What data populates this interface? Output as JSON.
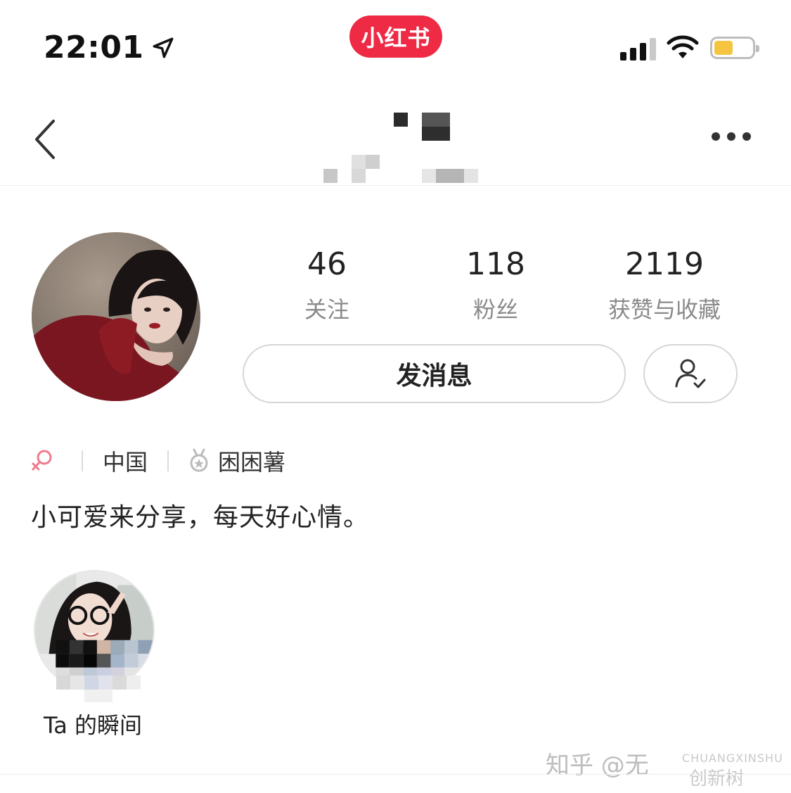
{
  "status_bar": {
    "time": "22:01",
    "app_badge": "小红书",
    "battery_color": "#f5c542"
  },
  "nav": {
    "back_icon": "chevron-left-icon",
    "more_icon": "ellipsis-icon"
  },
  "profile": {
    "stats": [
      {
        "value": "46",
        "label": "关注"
      },
      {
        "value": "118",
        "label": "粉丝"
      },
      {
        "value": "2119",
        "label": "获赞与收藏"
      }
    ],
    "message_button": "发消息",
    "follow_icon": "user-check-icon",
    "tags": {
      "gender_icon": "female-icon",
      "location": "中国",
      "level_icon": "medal-icon",
      "level": "困困薯"
    },
    "bio": "小可爱来分享，每天好心情。"
  },
  "moments": {
    "label": "Ta 的瞬间"
  },
  "watermark": {
    "zhihu": "知乎 @无",
    "brand_latin": "CHUANGXINSHU",
    "brand_cn": "创新树"
  },
  "colors": {
    "brand_red": "#ee2a45",
    "gender_pink": "#f07a8e"
  }
}
